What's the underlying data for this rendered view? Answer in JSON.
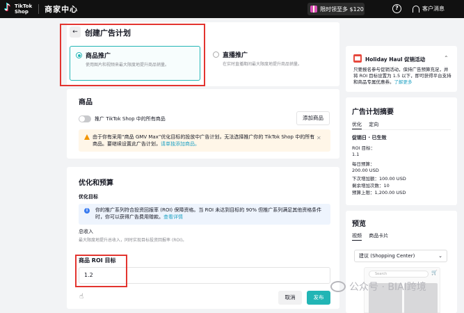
{
  "topbar": {
    "logo_line1": "TikTok",
    "logo_line2": "Shop",
    "title": "商家中心",
    "promo": "限时领至多 $120",
    "help": "?",
    "service": "客户消息"
  },
  "create": {
    "back_icon": "arrow-left-icon",
    "title": "创建广告计划",
    "options": [
      {
        "title": "商品推广",
        "desc": "使用图片和视频来最大限度地提升商品销量。",
        "selected": true
      },
      {
        "title": "直播推广",
        "desc": "在实时直播期间最大限度地提升商品销量。",
        "selected": false
      }
    ]
  },
  "products": {
    "title": "商品",
    "toggle_label": "推广 TikTok Shop 中的所有商品",
    "add_button": "添加商品",
    "warning_text": "由于你有采用“商品 GMV Max”优化目标的投放中广告计划，无法选择推广你的 TikTok Shop 中的所有商品。要继续设置此广告计划，",
    "warning_link": "请单独添加商品。"
  },
  "optimize": {
    "title": "优化和预算",
    "goal_label": "优化目标",
    "info_text": "你的推广系列符合投资回报率 (ROI) 保障资格。当 ROI 未达到目标的 90% 但推广系列满足其他资格条件时，你可以获得广告费用赠款。",
    "info_link": "查看详情",
    "revenue_label": "总收入",
    "revenue_desc": "最大限度地提升总收入，同时实现目标投资回报率 (ROI)。",
    "roi_label": "商品 ROI 目标",
    "roi_value": "1.2"
  },
  "actions": {
    "cancel": "取消",
    "publish": "发布"
  },
  "holiday": {
    "title": "Holiday Haul 促销活动",
    "desc": "只要报名参与促销活动，保持广告预算充足，并将 ROI 目标设置为 1.5 以下，即可获得平台支持和商品专属优惠券。",
    "link": "了解更多"
  },
  "summary": {
    "title": "广告计划摘要",
    "tabs": [
      "优化",
      "定向"
    ],
    "status_label": "促销日 · 已生效",
    "roi_label": "ROI 目标：",
    "roi_value": "1.1",
    "budget_label": "每日预算：",
    "budget_value": "200.00 USD",
    "line1": "下次增加额：100.00 USD",
    "line2": "剩余增加次数：10",
    "line3": "预算上限：1,200.00 USD"
  },
  "preview": {
    "title": "预览",
    "tabs": [
      "视频",
      "商品卡片"
    ],
    "select_value": "建议 (Shopping Center)",
    "search_placeholder": "Search"
  },
  "watermark": "公众号 · BIAI跨境",
  "colors": {
    "accent": "#22b5b5",
    "highlight": "#e3342f",
    "warn_bg": "#fff6e8",
    "info_bg": "#eef4fd"
  }
}
